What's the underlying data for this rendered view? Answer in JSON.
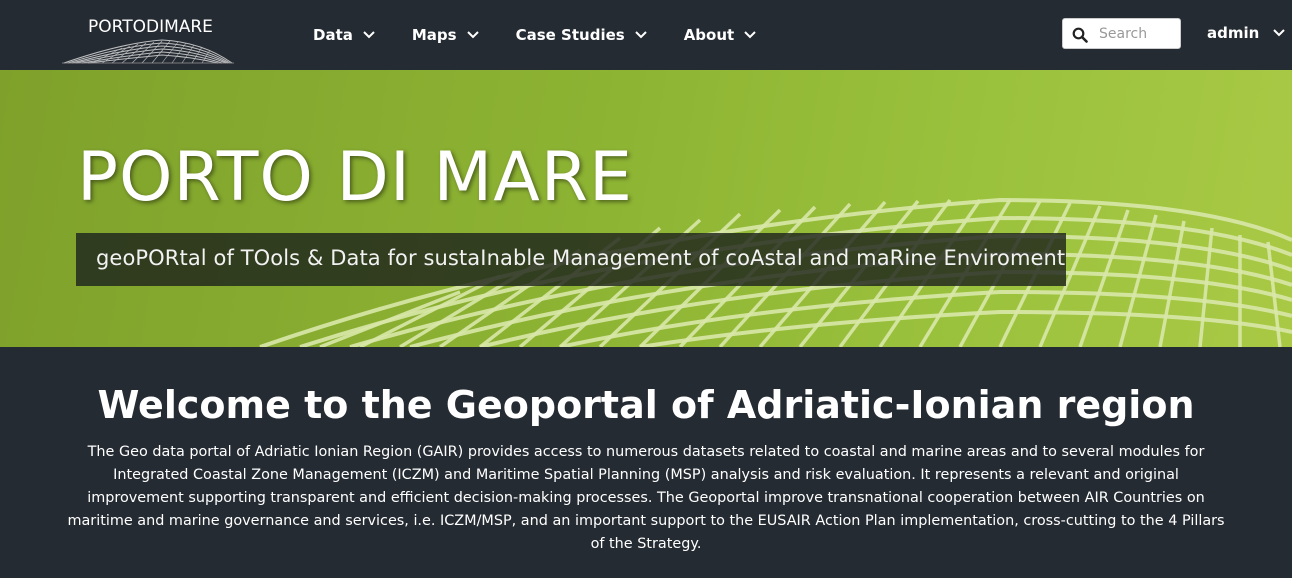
{
  "logo": {
    "text": "PORTODIMARE"
  },
  "nav": {
    "items": [
      {
        "label": "Data"
      },
      {
        "label": "Maps"
      },
      {
        "label": "Case Studies"
      },
      {
        "label": "About"
      }
    ]
  },
  "search": {
    "placeholder": "Search",
    "value": ""
  },
  "user": {
    "label": "admin"
  },
  "hero": {
    "title": "PORTO DI MARE",
    "subtitle": "geoPORtal of TOols & Data for sustaInable Management of coAstal and maRine Enviroment"
  },
  "welcome": {
    "title": "Welcome to the Geoportal of Adriatic-Ionian region",
    "text": "The Geo data portal of Adriatic Ionian Region (GAIR) provides access to numerous datasets related to coastal and marine areas and to several modules for Integrated Coastal Zone Management (ICZM) and Maritime Spatial Planning (MSP) analysis and risk evaluation. It represents a relevant and original improvement supporting transparent and efficient decision-making processes. The Geoportal improve transnational cooperation between AIR Countries on maritime and marine governance and services, i.e. ICZM/MSP, and an important support to the EUSAIR Action Plan implementation, cross-cutting to the 4 Pillars of the Strategy."
  },
  "colors": {
    "navbar": "#252b33",
    "hero_green": "#8db333",
    "body_bg": "#252b33"
  },
  "icons": {
    "search": "search-icon",
    "chevron": "chevron-down-icon"
  }
}
